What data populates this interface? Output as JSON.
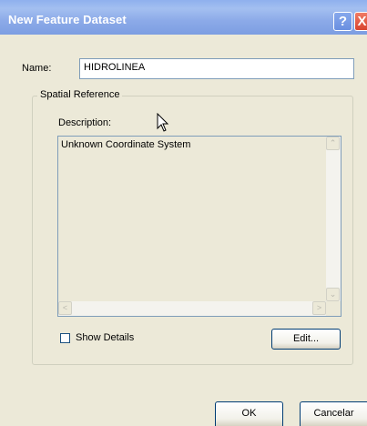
{
  "dialog": {
    "title": "New Feature Dataset",
    "help_symbol": "?",
    "close_symbol": "X"
  },
  "name_field": {
    "label": "Name:",
    "value": "HIDROLINEA"
  },
  "spatial_reference": {
    "group_title": "Spatial Reference",
    "description_label": "Description:",
    "description_text": "Unknown Coordinate System",
    "scroll_up": "⌃",
    "scroll_down": "⌄",
    "scroll_left": "<",
    "scroll_right": ">"
  },
  "show_details": {
    "label": "Show Details",
    "checked": false
  },
  "buttons": {
    "edit": "Edit...",
    "ok": "OK",
    "cancel": "Cancelar"
  },
  "icons": {
    "cursor": "mouse-pointer-icon"
  }
}
